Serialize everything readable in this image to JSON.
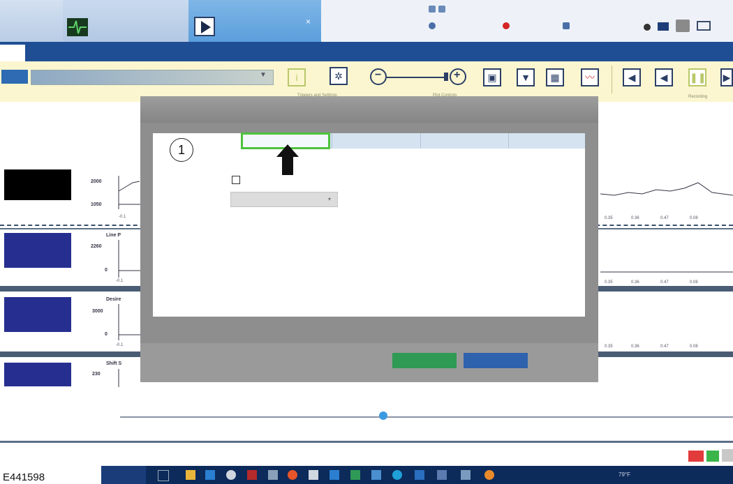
{
  "figure": {
    "label": "E441598"
  },
  "titlebar": {
    "tab_close": "×",
    "tray_speed": "79°F"
  },
  "toolbar": {
    "cap_trigger": "Triggers and Settings",
    "cap_plot": "Plot Controls",
    "cap_recording": "Recording",
    "info_glyph": "i",
    "zoom_minus": "−",
    "zoom_plus": "+"
  },
  "channels": [
    {
      "y_top": "2000",
      "y_bottom": "1050",
      "x_first": "-0.1",
      "name": ""
    },
    {
      "y_top": "2260",
      "y_bottom": "0",
      "x_first": "-0.1",
      "name": "Line P"
    },
    {
      "y_top": "3000",
      "y_bottom": "0",
      "x_first": "-0.1",
      "name": "Desire"
    },
    {
      "y_top": "230",
      "y_bottom": "",
      "x_first": "",
      "name": "Shift S"
    }
  ],
  "x_ticks": [
    "0.35",
    "0.36",
    "0.47",
    "0.08"
  ],
  "dialog": {
    "callout": "1"
  },
  "colors": {
    "accent_green": "#4cc23e",
    "ok_green": "#2f9a53",
    "cancel_blue": "#2e62ad",
    "ribbon_blue": "#1f4e95",
    "toolbar_yellow": "#fbf6cf"
  }
}
